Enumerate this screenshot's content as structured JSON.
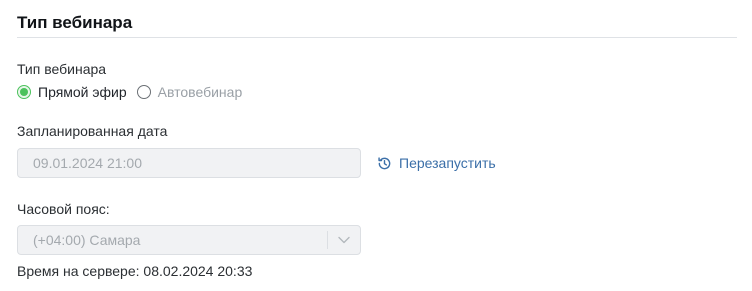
{
  "section": {
    "title": "Тип вебинара"
  },
  "webinar_type": {
    "label": "Тип вебинара",
    "options": [
      {
        "label": "Прямой эфир",
        "selected": true
      },
      {
        "label": "Автовебинар",
        "selected": false
      }
    ]
  },
  "scheduled_date": {
    "label": "Запланированная дата",
    "value": "09.01.2024 21:00",
    "restart_label": "Перезапустить",
    "restart_icon": "history-icon"
  },
  "timezone": {
    "label": "Часовой пояс:",
    "selected_value": "(+04:00) Самара",
    "arrow_icon": "chevron-down-icon"
  },
  "server_time": {
    "text": "Время на сервере: 08.02.2024 20:33"
  },
  "colors": {
    "accent_green": "#4cc25d",
    "link_blue": "#3b6fa8",
    "disabled_bg": "#f1f2f4"
  }
}
